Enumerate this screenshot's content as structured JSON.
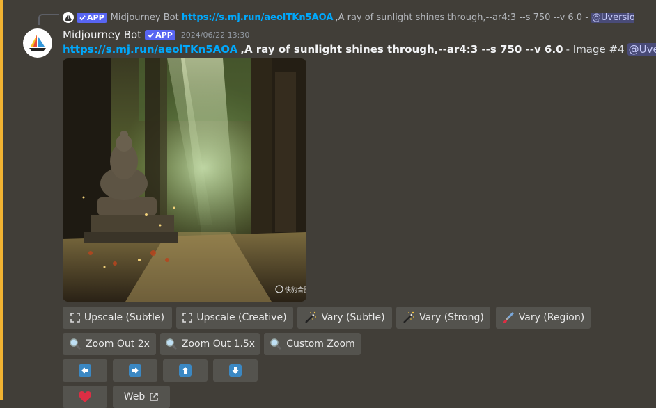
{
  "reply": {
    "badge": "APP",
    "author": "Midjourney Bot",
    "link": "https://s.mj.run/aeolTKn5AOA",
    "prompt": ",A ray of sunlight shines through,--ar4:3 --s 750 --v 6.0 -",
    "mention": "@Uversion..."
  },
  "message": {
    "author": "Midjourney Bot",
    "badge": "APP",
    "timestamp": "2024/06/22 13:30",
    "link": "https://s.mj.run/aeolTKn5AOA",
    "prompt": ",A ray of sunlight shines through,--ar4:3 --s 750 --v 6.0",
    "suffix": "- Image #4",
    "mention": "@Uversion"
  },
  "image": {
    "watermark": "快豹合图"
  },
  "buttons": {
    "upscale_subtle": "Upscale (Subtle)",
    "upscale_creative": "Upscale (Creative)",
    "vary_subtle": "Vary (Subtle)",
    "vary_strong": "Vary (Strong)",
    "vary_region": "Vary (Region)",
    "zoom_out_2x": "Zoom Out 2x",
    "zoom_out_1_5x": "Zoom Out 1.5x",
    "custom_zoom": "Custom Zoom",
    "web": "Web"
  },
  "colors": {
    "background": "#413e38",
    "highlight": "#f0b232",
    "button": "#54534e",
    "link": "#00a8fc",
    "badge": "#5865f2",
    "arrow": "#3b88c3",
    "heart": "#dd2e44"
  },
  "icons": {
    "expand": "expand-icon",
    "wand": "magic-wand-icon",
    "brush": "paintbrush-icon",
    "magnifier": "magnifier-icon",
    "arrows": [
      "arrow-left-icon",
      "arrow-right-icon",
      "arrow-up-icon",
      "arrow-down-icon"
    ],
    "heart": "heart-icon",
    "external": "external-link-icon"
  }
}
